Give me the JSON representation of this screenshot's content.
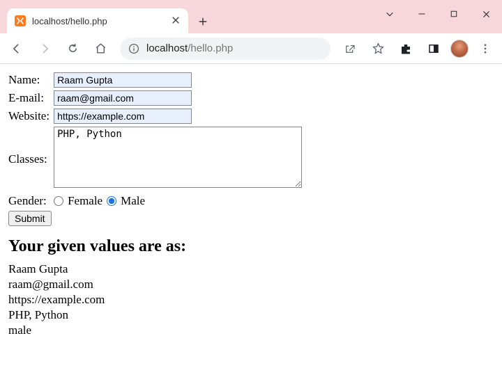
{
  "browser": {
    "tab_title": "localhost/hello.php",
    "url_host": "localhost",
    "url_path": "/hello.php"
  },
  "form": {
    "name_label": "Name:",
    "name_value": "Raam Gupta",
    "email_label": "E-mail:",
    "email_value": "raam@gmail.com",
    "website_label": "Website:",
    "website_value": "https://example.com",
    "classes_label": "Classes:",
    "classes_value": "PHP, Python",
    "gender_label": "Gender:",
    "gender_female": "Female",
    "gender_male": "Male",
    "gender_selected": "male",
    "submit_label": "Submit"
  },
  "output": {
    "heading": "Your given values are as:",
    "lines": {
      "name": "Raam Gupta",
      "email": "raam@gmail.com",
      "website": "https://example.com",
      "classes": "PHP, Python",
      "gender": "male"
    }
  }
}
